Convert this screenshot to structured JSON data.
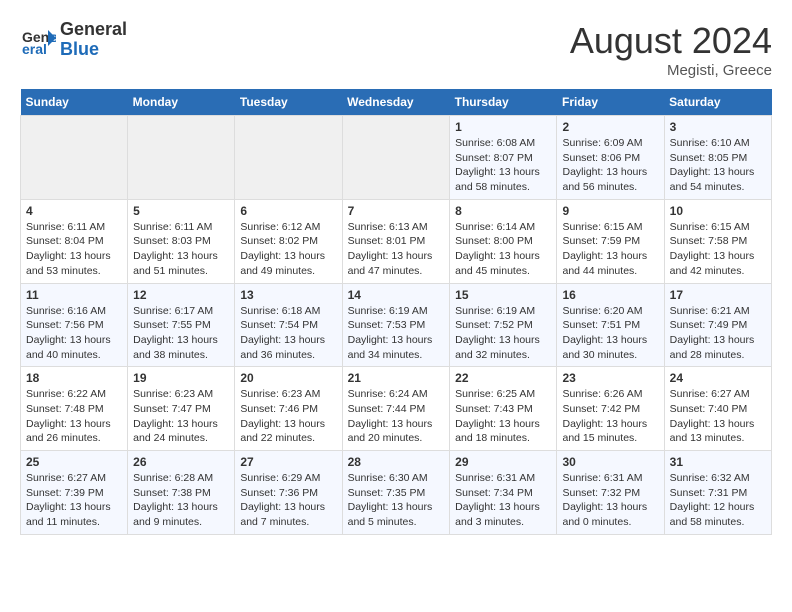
{
  "header": {
    "logo_general": "General",
    "logo_blue": "Blue",
    "main_title": "August 2024",
    "subtitle": "Megisti, Greece"
  },
  "days_of_week": [
    "Sunday",
    "Monday",
    "Tuesday",
    "Wednesday",
    "Thursday",
    "Friday",
    "Saturday"
  ],
  "weeks": [
    [
      {
        "day": "",
        "empty": true
      },
      {
        "day": "",
        "empty": true
      },
      {
        "day": "",
        "empty": true
      },
      {
        "day": "",
        "empty": true
      },
      {
        "day": "1",
        "sunrise": "6:08 AM",
        "sunset": "8:07 PM",
        "daylight": "13 hours and 58 minutes."
      },
      {
        "day": "2",
        "sunrise": "6:09 AM",
        "sunset": "8:06 PM",
        "daylight": "13 hours and 56 minutes."
      },
      {
        "day": "3",
        "sunrise": "6:10 AM",
        "sunset": "8:05 PM",
        "daylight": "13 hours and 54 minutes."
      }
    ],
    [
      {
        "day": "4",
        "sunrise": "6:11 AM",
        "sunset": "8:04 PM",
        "daylight": "13 hours and 53 minutes."
      },
      {
        "day": "5",
        "sunrise": "6:11 AM",
        "sunset": "8:03 PM",
        "daylight": "13 hours and 51 minutes."
      },
      {
        "day": "6",
        "sunrise": "6:12 AM",
        "sunset": "8:02 PM",
        "daylight": "13 hours and 49 minutes."
      },
      {
        "day": "7",
        "sunrise": "6:13 AM",
        "sunset": "8:01 PM",
        "daylight": "13 hours and 47 minutes."
      },
      {
        "day": "8",
        "sunrise": "6:14 AM",
        "sunset": "8:00 PM",
        "daylight": "13 hours and 45 minutes."
      },
      {
        "day": "9",
        "sunrise": "6:15 AM",
        "sunset": "7:59 PM",
        "daylight": "13 hours and 44 minutes."
      },
      {
        "day": "10",
        "sunrise": "6:15 AM",
        "sunset": "7:58 PM",
        "daylight": "13 hours and 42 minutes."
      }
    ],
    [
      {
        "day": "11",
        "sunrise": "6:16 AM",
        "sunset": "7:56 PM",
        "daylight": "13 hours and 40 minutes."
      },
      {
        "day": "12",
        "sunrise": "6:17 AM",
        "sunset": "7:55 PM",
        "daylight": "13 hours and 38 minutes."
      },
      {
        "day": "13",
        "sunrise": "6:18 AM",
        "sunset": "7:54 PM",
        "daylight": "13 hours and 36 minutes."
      },
      {
        "day": "14",
        "sunrise": "6:19 AM",
        "sunset": "7:53 PM",
        "daylight": "13 hours and 34 minutes."
      },
      {
        "day": "15",
        "sunrise": "6:19 AM",
        "sunset": "7:52 PM",
        "daylight": "13 hours and 32 minutes."
      },
      {
        "day": "16",
        "sunrise": "6:20 AM",
        "sunset": "7:51 PM",
        "daylight": "13 hours and 30 minutes."
      },
      {
        "day": "17",
        "sunrise": "6:21 AM",
        "sunset": "7:49 PM",
        "daylight": "13 hours and 28 minutes."
      }
    ],
    [
      {
        "day": "18",
        "sunrise": "6:22 AM",
        "sunset": "7:48 PM",
        "daylight": "13 hours and 26 minutes."
      },
      {
        "day": "19",
        "sunrise": "6:23 AM",
        "sunset": "7:47 PM",
        "daylight": "13 hours and 24 minutes."
      },
      {
        "day": "20",
        "sunrise": "6:23 AM",
        "sunset": "7:46 PM",
        "daylight": "13 hours and 22 minutes."
      },
      {
        "day": "21",
        "sunrise": "6:24 AM",
        "sunset": "7:44 PM",
        "daylight": "13 hours and 20 minutes."
      },
      {
        "day": "22",
        "sunrise": "6:25 AM",
        "sunset": "7:43 PM",
        "daylight": "13 hours and 18 minutes."
      },
      {
        "day": "23",
        "sunrise": "6:26 AM",
        "sunset": "7:42 PM",
        "daylight": "13 hours and 15 minutes."
      },
      {
        "day": "24",
        "sunrise": "6:27 AM",
        "sunset": "7:40 PM",
        "daylight": "13 hours and 13 minutes."
      }
    ],
    [
      {
        "day": "25",
        "sunrise": "6:27 AM",
        "sunset": "7:39 PM",
        "daylight": "13 hours and 11 minutes."
      },
      {
        "day": "26",
        "sunrise": "6:28 AM",
        "sunset": "7:38 PM",
        "daylight": "13 hours and 9 minutes."
      },
      {
        "day": "27",
        "sunrise": "6:29 AM",
        "sunset": "7:36 PM",
        "daylight": "13 hours and 7 minutes."
      },
      {
        "day": "28",
        "sunrise": "6:30 AM",
        "sunset": "7:35 PM",
        "daylight": "13 hours and 5 minutes."
      },
      {
        "day": "29",
        "sunrise": "6:31 AM",
        "sunset": "7:34 PM",
        "daylight": "13 hours and 3 minutes."
      },
      {
        "day": "30",
        "sunrise": "6:31 AM",
        "sunset": "7:32 PM",
        "daylight": "13 hours and 0 minutes."
      },
      {
        "day": "31",
        "sunrise": "6:32 AM",
        "sunset": "7:31 PM",
        "daylight": "12 hours and 58 minutes."
      }
    ]
  ]
}
